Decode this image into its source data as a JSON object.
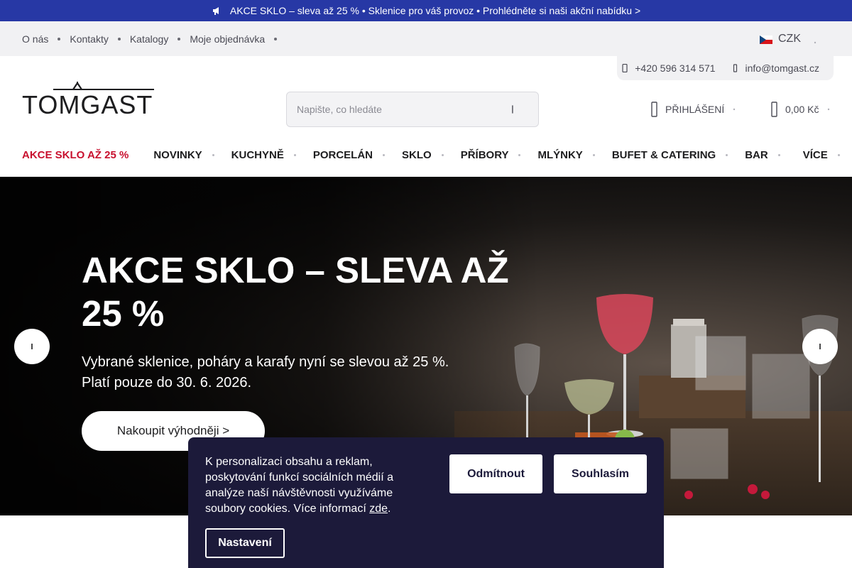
{
  "promo_bar": {
    "text": "AKCE SKLO – sleva až 25 % • Sklenice pro váš provoz • Prohlédněte si naši akční nabídku >",
    "icon": "megaphone-icon"
  },
  "topbar": {
    "links": [
      "O nás",
      "Kontakty",
      "Katalogy",
      "Moje objednávka"
    ],
    "currency": "CZK"
  },
  "contacts": {
    "phone": "+420 596 314 571",
    "email": "info@tomgast.cz"
  },
  "logo": {
    "text": "TOMGAST"
  },
  "search": {
    "placeholder": "Napište, co hledáte"
  },
  "account": {
    "login_label": "PŘIHLÁŠENÍ"
  },
  "cart": {
    "total": "0,00 Kč"
  },
  "nav": {
    "promo": "AKCE SKLO AŽ 25 %",
    "items": [
      "NOVINKY",
      "KUCHYNĚ",
      "PORCELÁN",
      "SKLO",
      "PŘÍBORY",
      "MLÝNKY",
      "BUFET & CATERING",
      "BAR",
      "VÍCE"
    ]
  },
  "hero": {
    "title": "AKCE SKLO – SLEVA AŽ 25 %",
    "subtitle_line1": "Vybrané sklenice, poháry a karafy nyní se slevou až 25 %.",
    "subtitle_line2": "Platí pouze do 30. 6. 2026.",
    "cta": "Nakoupit výhodněji >"
  },
  "cookie": {
    "text_before_link": "K personalizaci obsahu a reklam, poskytování funkcí sociálních médií a analýze naší návštěvnosti využíváme soubory cookies. Více informací ",
    "link_text": "zde",
    "text_after_link": ".",
    "decline": "Odmítnout",
    "accept": "Souhlasím",
    "settings": "Nastavení"
  },
  "colors": {
    "promo_bar": "#2738a5",
    "nav_promo": "#c8102e",
    "cookie_bg": "#1c1a3a",
    "topbar_bg": "#f1f1f3"
  }
}
